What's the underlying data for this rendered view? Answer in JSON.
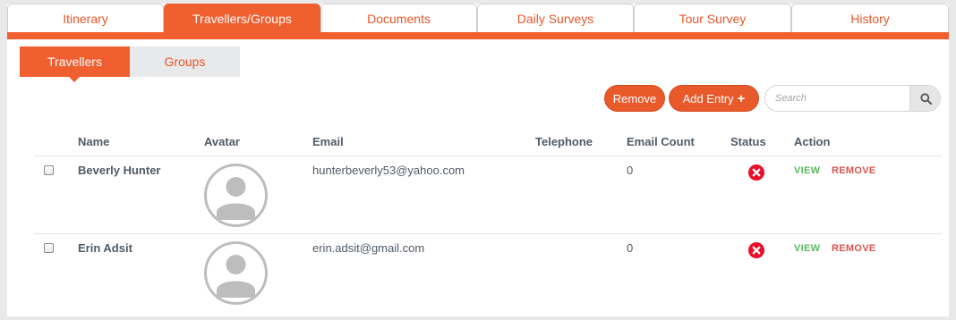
{
  "tabs": [
    {
      "label": "Itinerary",
      "active": false
    },
    {
      "label": "Travellers/Groups",
      "active": true
    },
    {
      "label": "Documents",
      "active": false
    },
    {
      "label": "Daily Surveys",
      "active": false
    },
    {
      "label": "Tour Survey",
      "active": false
    },
    {
      "label": "History",
      "active": false
    }
  ],
  "subtabs": {
    "travellers": "Travellers",
    "groups": "Groups"
  },
  "toolbar": {
    "remove_label": "Remove",
    "add_entry_label": "Add Entry",
    "add_icon": "+"
  },
  "search": {
    "placeholder": "Search",
    "icon": "search-icon"
  },
  "table": {
    "headers": [
      "Name",
      "Avatar",
      "Email",
      "Telephone",
      "Email Count",
      "Status",
      "Action"
    ],
    "rows": [
      {
        "name": "Beverly Hunter",
        "email": "hunterbeverly53@yahoo.com",
        "telephone": "",
        "email_count": "0",
        "status": "inactive",
        "view_label": "VIEW",
        "remove_label": "REMOVE"
      },
      {
        "name": "Erin Adsit",
        "email": "erin.adsit@gmail.com",
        "telephone": "",
        "email_count": "0",
        "status": "inactive",
        "view_label": "VIEW",
        "remove_label": "REMOVE"
      }
    ]
  },
  "colors": {
    "accent": "#ef5f2f",
    "view": "#5cb85c",
    "remove": "#d9534f",
    "status_error": "#e8102a"
  }
}
